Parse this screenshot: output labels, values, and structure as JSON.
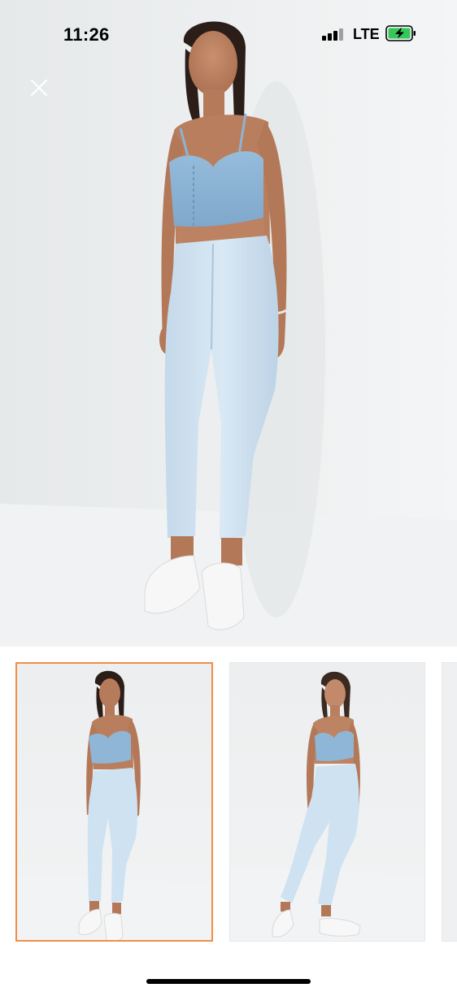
{
  "status_bar": {
    "time": "11:26",
    "network": "LTE",
    "signal_bars": 4,
    "signal_bars_active": 3,
    "battery_icon": "battery-charging-icon",
    "battery_color": "#34c759"
  },
  "viewer": {
    "close_icon": "close-icon",
    "main_image_icon": "product-photo-model-denim-outfit",
    "thumbnails": [
      {
        "icon": "product-photo-front-view",
        "selected": true
      },
      {
        "icon": "product-photo-three-quarter-view",
        "selected": false
      },
      {
        "icon": "product-photo-partial",
        "selected": false
      }
    ],
    "selected_border_color": "#f08f46"
  },
  "colors": {
    "denim_top": "#8fb6d6",
    "denim_jeans": "#cfe2f1",
    "background": "#eef0f1"
  }
}
